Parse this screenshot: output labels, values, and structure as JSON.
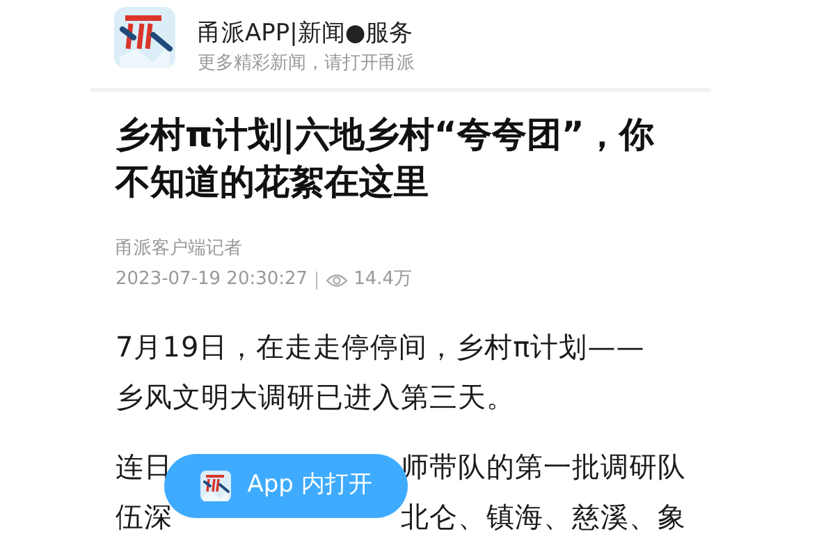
{
  "header": {
    "title": "甬派APP|新闻●服务",
    "subtitle": "更多精彩新闻，请打开甬派"
  },
  "article": {
    "headline": "乡村π计划|六地乡村“夸夸团”，你不知道的花絮在这里",
    "author": "甬派客户端记者",
    "datetime": "2023-07-19 20:30:27",
    "views": "14.4万",
    "paragraphs": [
      {
        "lines": [
          [
            "7月19日，在走走停停间，乡村π计划——"
          ],
          [
            "乡风文明大调研已进入第三天。"
          ]
        ]
      },
      {
        "lines": [
          [
            "连日",
            "师带队的第一批调研队"
          ],
          [
            "伍深",
            "北仑、镇海、慈溪、象"
          ]
        ]
      }
    ]
  },
  "open_button": {
    "label": "App 内打开"
  }
}
